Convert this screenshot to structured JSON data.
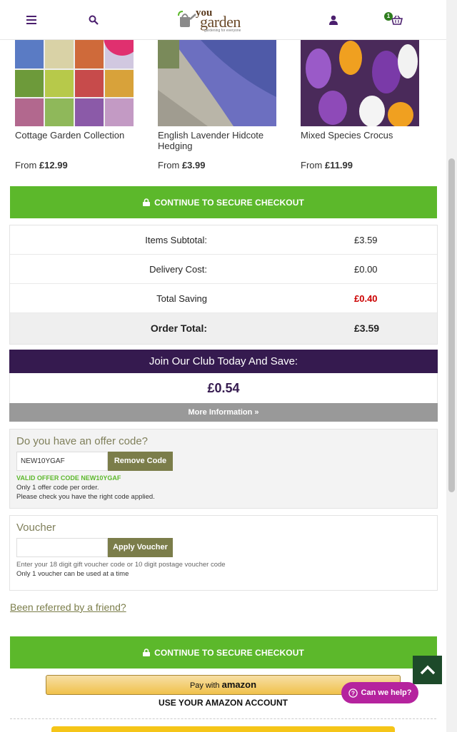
{
  "header": {
    "cart_count": "1",
    "logo_you": "you",
    "logo_garden": "garden",
    "logo_tagline": "gardening for everyone"
  },
  "products": [
    {
      "name": "Cottage Garden Collection",
      "from": "From ",
      "price": "£12.99"
    },
    {
      "name": "English Lavender Hidcote Hedging",
      "from": "From ",
      "price": "£3.99"
    },
    {
      "name": "Mixed Species Crocus",
      "from": "From ",
      "price": "£11.99"
    }
  ],
  "checkout": {
    "label": "CONTINUE TO SECURE CHECKOUT"
  },
  "totals": {
    "subtotal_label": "Items Subtotal:",
    "subtotal_value": "£3.59",
    "delivery_label": "Delivery Cost:",
    "delivery_value": "£0.00",
    "saving_label": "Total Saving",
    "saving_value": "£0.40",
    "order_label": "Order Total:",
    "order_value": "£3.59"
  },
  "club": {
    "heading": "Join Our Club Today And Save:",
    "amount": "£0.54",
    "more": "More Information »"
  },
  "offer": {
    "title": "Do you have an offer code?",
    "code_value": "NEW10YGAF",
    "button": "Remove Code",
    "valid_text": "VALID OFFER CODE NEW10YGAF",
    "note1": "Only 1 offer code per order.",
    "note2": "Please check you have the right code applied."
  },
  "voucher": {
    "title": "Voucher",
    "value": "",
    "button": "Apply Voucher",
    "note1": "Enter your 18 digit gift voucher code or 10 digit postage voucher code",
    "note2": "Only 1 voucher can be used at a time"
  },
  "referral": "Been referred by a friend?",
  "amazon": {
    "pay_with": "Pay with ",
    "brand": "amazon",
    "sub": "USE YOUR AMAZON ACCOUNT"
  },
  "help": {
    "label": "Can we help?"
  },
  "colors": {
    "purple": "#351a4f",
    "green": "#5cb82b",
    "olive": "#7b7d4a",
    "saving_red": "#cc0000"
  }
}
